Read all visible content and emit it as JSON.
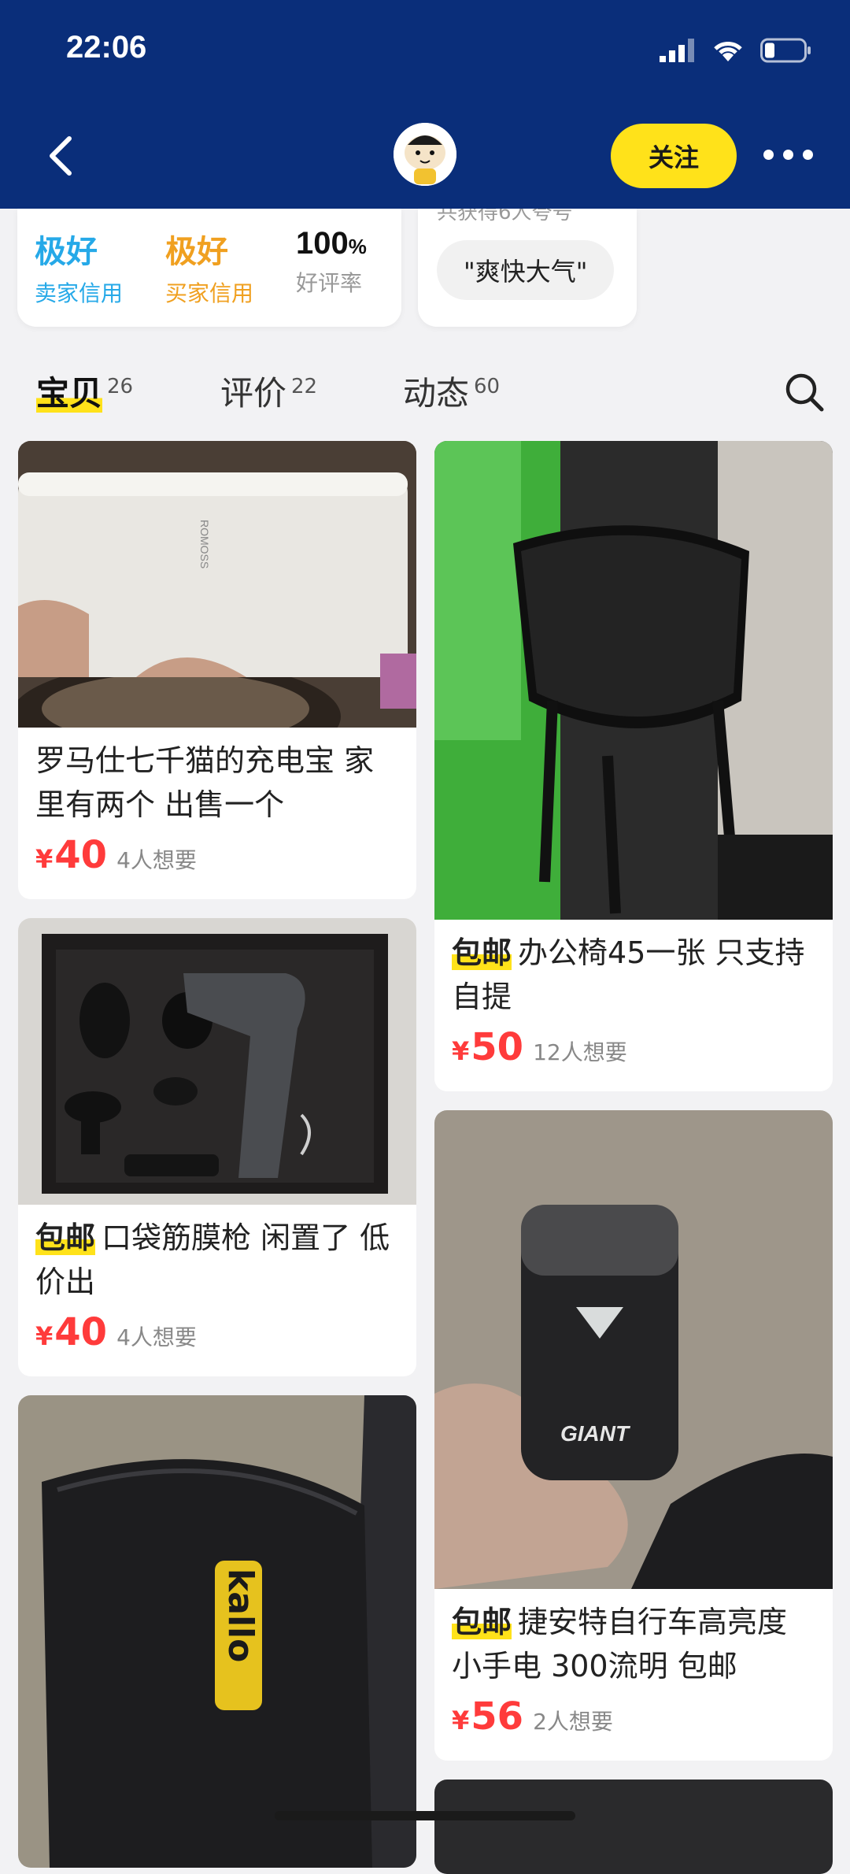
{
  "status": {
    "time": "22:06"
  },
  "header": {
    "follow_label": "关注",
    "more_icon": "more-dots-icon",
    "back_icon": "chevron-left-icon"
  },
  "credits": {
    "seller": {
      "value": "极好",
      "label": "卖家信用",
      "color": "#26a9e8"
    },
    "buyer": {
      "value": "极好",
      "label": "买家信用",
      "color": "#f0a020"
    },
    "rating": {
      "value": "100",
      "unit": "%",
      "label": "好评率"
    }
  },
  "tags": {
    "partial_text": "共获得6人夸号",
    "pill": "\"爽快大气\""
  },
  "tabs": [
    {
      "label": "宝贝",
      "count": "26"
    },
    {
      "label": "评价",
      "count": "22"
    },
    {
      "label": "动态",
      "count": "60"
    }
  ],
  "products": {
    "left": [
      {
        "badge": "",
        "title": "罗马仕七千猫的充电宝 家里有两个  出售一个",
        "currency": "¥",
        "price": "40",
        "wants": "4人想要"
      },
      {
        "badge": "包邮",
        "title": "口袋筋膜枪  闲置了 低价出",
        "currency": "¥",
        "price": "40",
        "wants": "4人想要"
      },
      {
        "badge": "",
        "title": "",
        "currency": "",
        "price": "",
        "wants": ""
      }
    ],
    "right": [
      {
        "badge": "包邮",
        "title": "办公椅45一张  只支持自提",
        "currency": "¥",
        "price": "50",
        "wants": "12人想要"
      },
      {
        "badge": "包邮",
        "title": "捷安特自行车高亮度小手电  300流明  包邮",
        "currency": "¥",
        "price": "56",
        "wants": "2人想要"
      }
    ]
  },
  "photo_text": {
    "powerbank_brand": "ROMOSS",
    "light_brand": "GIANT",
    "case_brand": "kallo"
  }
}
